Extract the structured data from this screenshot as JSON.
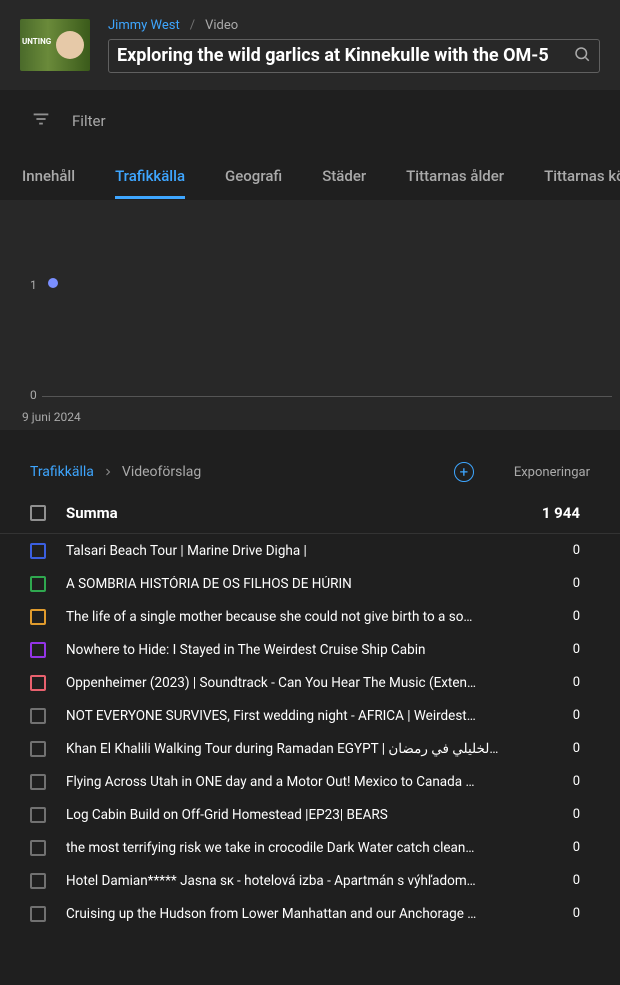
{
  "breadcrumb": {
    "author": "Jimmy West",
    "page": "Video"
  },
  "video_title": "Exploring the wild garlics at Kinnekulle with the OM-5",
  "filter_label": "Filter",
  "tabs": [
    "Innehåll",
    "Trafikkälla",
    "Geografi",
    "Städer",
    "Tittarnas ålder",
    "Tittarnas kön"
  ],
  "tabs_active_index": 1,
  "chart": {
    "y_ticks": [
      "1",
      "0"
    ],
    "x_label": "9 juni 2024"
  },
  "chart_data": {
    "type": "line",
    "x": [
      "9 juni 2024"
    ],
    "values": [
      1
    ],
    "ylim": [
      0,
      1
    ],
    "title": "",
    "xlabel": "",
    "ylabel": ""
  },
  "crumb": {
    "link": "Trafikkälla",
    "current": "Videoförslag"
  },
  "column_header": "Exponeringar",
  "summa_label": "Summa",
  "summa_value": "1 944",
  "rows": [
    {
      "color": "blue",
      "title": "Talsari Beach Tour | Marine Drive Digha |",
      "value": "0"
    },
    {
      "color": "green",
      "title": "A SOMBRIA HISTÓRIA DE OS FILHOS DE HÚRIN",
      "value": "0"
    },
    {
      "color": "orange",
      "title": "The life of a single mother because she could not give birth to a so…",
      "value": "0"
    },
    {
      "color": "purple",
      "title": "Nowhere to Hide: I Stayed in The Weirdest Cruise Ship Cabin",
      "value": "0"
    },
    {
      "color": "red",
      "title": "Oppenheimer (2023) | Soundtrack - Can You Hear The Music (Exten…",
      "value": "0"
    },
    {
      "color": "grey",
      "title": "NOT EVERYONE SURVIVES, First wedding night - AFRICA | Weirdest…",
      "value": "0"
    },
    {
      "color": "grey",
      "title": "Khan El Khalili Walking Tour during Ramadan EGYPT | الخليلي في رمضان…",
      "value": "0"
    },
    {
      "color": "grey",
      "title": "Flying Across Utah in ONE day and a Motor Out! Mexico to Canada …",
      "value": "0"
    },
    {
      "color": "grey",
      "title": "Log Cabin Build on Off-Grid Homestead |EP23| BEARS",
      "value": "0"
    },
    {
      "color": "grey",
      "title": "the most terrifying risk we take in crocodile Dark Water catch clean…",
      "value": "0"
    },
    {
      "color": "grey",
      "title": "Hotel Damian***** Jasna sᴋ - hotelová izba - Apartmán s výhľadom…",
      "value": "0"
    },
    {
      "color": "grey",
      "title": "Cruising up the Hudson from Lower Manhattan and our Anchorage …",
      "value": "0"
    }
  ]
}
